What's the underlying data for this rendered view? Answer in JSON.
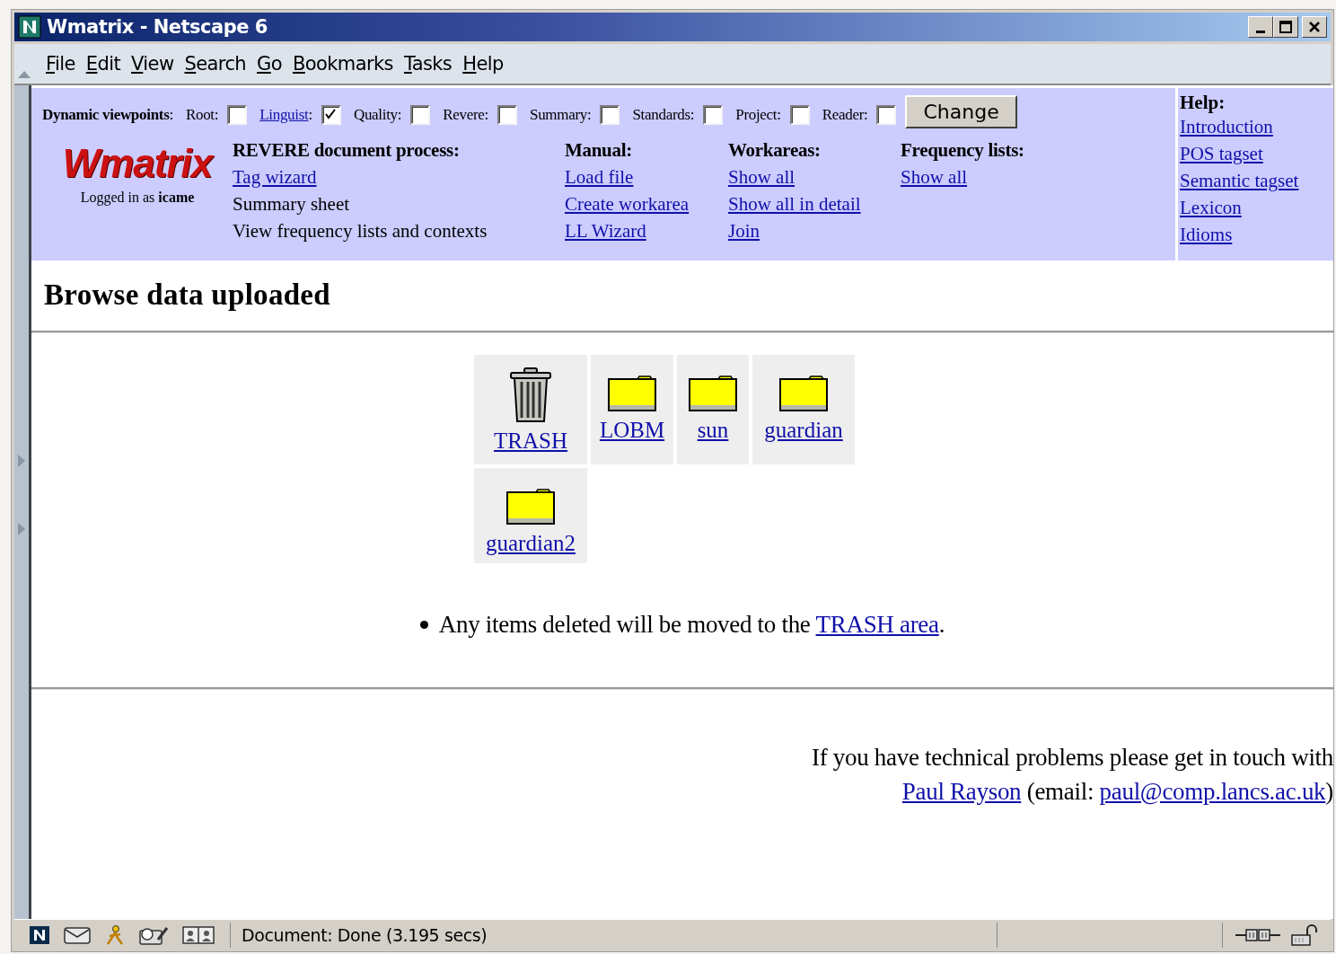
{
  "window": {
    "title": "Wmatrix - Netscape 6"
  },
  "menu": [
    "File",
    "Edit",
    "View",
    "Search",
    "Go",
    "Bookmarks",
    "Tasks",
    "Help"
  ],
  "viewpoints": {
    "title": "**Dynamic viewpoints**:",
    "items": [
      {
        "label": "Root:",
        "link": false,
        "checked": false
      },
      {
        "label": "Linguist",
        "suffix": ":",
        "link": true,
        "checked": true
      },
      {
        "label": "Quality:",
        "link": false,
        "checked": false
      },
      {
        "label": "Revere:",
        "link": false,
        "checked": false
      },
      {
        "label": "Summary:",
        "link": false,
        "checked": false
      },
      {
        "label": "Standards:",
        "link": false,
        "checked": false
      },
      {
        "label": "Project:",
        "link": false,
        "checked": false
      },
      {
        "label": "Reader:",
        "link": false,
        "checked": false
      }
    ]
  },
  "change_button": "Change",
  "logo": {
    "text": "Wmatrix",
    "login": "Logged in as **icame**"
  },
  "sections": [
    {
      "heading": "REVERE document process:",
      "items": [
        {
          "text": "Tag wizard",
          "link": true
        },
        {
          "text": "Summary sheet",
          "link": false
        },
        {
          "text": "View frequency lists and contexts",
          "link": false
        }
      ]
    },
    {
      "heading": "Manual:",
      "items": [
        {
          "text": "Load file",
          "link": true
        },
        {
          "text": "Create workarea",
          "link": true
        },
        {
          "text": "LL Wizard",
          "link": true
        }
      ]
    },
    {
      "heading": "Workareas:",
      "items": [
        {
          "text": "Show all",
          "link": true
        },
        {
          "text": "Show all in detail",
          "link": true
        },
        {
          "text": "Join",
          "link": true
        }
      ]
    },
    {
      "heading": "Frequency lists:",
      "items": [
        {
          "text": "Show all",
          "link": true
        }
      ]
    }
  ],
  "help": {
    "heading": "Help:",
    "links": [
      "Introduction",
      "POS tagset",
      "Semantic tagset",
      "Lexicon",
      "Idioms"
    ]
  },
  "page_title": "Browse data uploaded",
  "folders": [
    {
      "kind": "trash",
      "label": "TRASH"
    },
    {
      "kind": "folder",
      "label": "LOBM"
    },
    {
      "kind": "folder",
      "label": "sun"
    },
    {
      "kind": "folder",
      "label": "guardian"
    },
    {
      "kind": "folder",
      "label": "guardian2"
    }
  ],
  "notes": [
    {
      "text": "Any items deleted will be moved to the",
      "link": "TRASH area",
      "after": "."
    }
  ],
  "footer": {
    "text": "If you have technical problems please get in touch with",
    "name_link": "Paul Rayson",
    "email_prefix": "(email:",
    "email_link": "paul@comp.lancs.ac.uk",
    "email_suffix": ")"
  },
  "status_bar": {
    "text": "Document: Done (3.195 secs)"
  }
}
